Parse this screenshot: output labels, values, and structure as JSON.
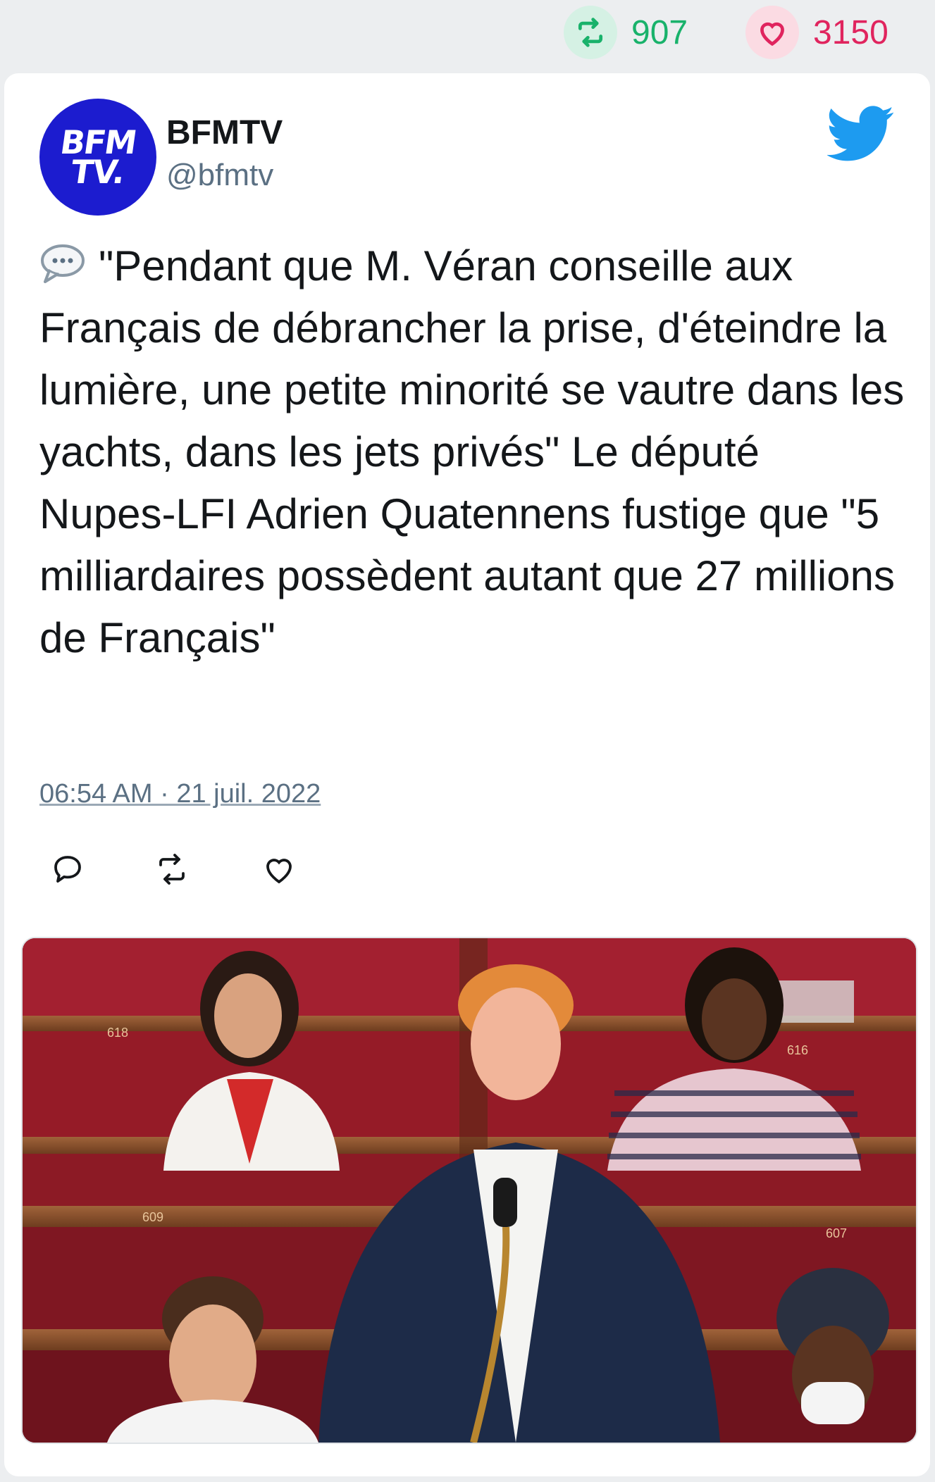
{
  "stats": {
    "retweets": "907",
    "likes": "3150",
    "retweet_color": "#19b26b",
    "like_color": "#e0245e"
  },
  "author": {
    "avatar_text_line1": "BFM",
    "avatar_text_line2": "TV.",
    "display_name": "BFMTV",
    "handle": "@bfmtv"
  },
  "tweet": {
    "text": "\"Pendant que M. Véran conseille aux Français de débrancher la prise, d'éteindre la lumière, une petite minorité se vautre dans les yachts, dans les jets privés\" Le député Nupes-LFI Adrien Quatennens fustige que \"5 milliardaires possèdent autant que 27 millions de Français\"",
    "timestamp": "06:54 AM · 21 juil. 2022",
    "leading_icon": "speech-bubble-icon"
  },
  "media": {
    "seat_labels": [
      "618",
      "616",
      "609",
      "607"
    ]
  },
  "icons": {
    "brand": "twitter-bird-icon",
    "reply": "reply-icon",
    "retweet": "retweet-icon",
    "like": "heart-icon"
  },
  "colors": {
    "brand_blue": "#1d9bf0",
    "avatar_blue": "#1c1ccf",
    "text": "#14171a",
    "muted": "#5b7083"
  }
}
